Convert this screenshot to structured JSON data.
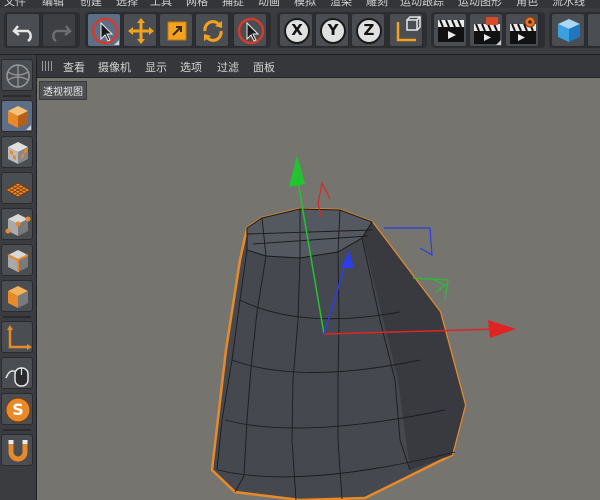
{
  "menubar": {
    "items": [
      "文件",
      "编辑",
      "创建",
      "选择",
      "工具",
      "网格",
      "捕捉",
      "动画",
      "模拟",
      "渲染",
      "雕刻",
      "运动跟踪",
      "运动图形",
      "角色",
      "流水线"
    ]
  },
  "toolbar": {
    "undo_icon": "undo-icon",
    "redo_icon": "redo-icon",
    "select_icon": "live-select-icon",
    "move_icon": "move-icon",
    "scale_icon": "scale-icon",
    "rotate_icon": "rotate-icon",
    "last_tool_icon": "last-tool-icon",
    "axis_x_label": "X",
    "axis_y_label": "Y",
    "axis_z_label": "Z",
    "coord_icon": "coordinate-system-icon",
    "render_view_icon": "render-view-icon",
    "render_picture_icon": "render-to-picture-viewer-icon",
    "render_settings_icon": "render-settings-icon",
    "cube_icon": "cube-object-icon"
  },
  "lefttools": {
    "items": [
      "make-editable-icon",
      "texture-mode-icon",
      "workplane-icon",
      "points-mode-icon",
      "edges-mode-icon",
      "polygons-mode-icon",
      "axis-mode-icon",
      "tweak-mode-icon",
      "snap-icon",
      "magnet-icon"
    ]
  },
  "viewport_menu": {
    "items": [
      "查看",
      "摄像机",
      "显示",
      "选项",
      "过滤",
      "面板"
    ]
  },
  "viewport": {
    "label": "透视视图"
  },
  "colors": {
    "viewport_bg": "#75746f",
    "mesh_face": "#4b4e55",
    "selection_outline": "#e88a2a",
    "axis_x": "#e02424",
    "axis_y": "#22c430",
    "axis_z": "#2b3ee8"
  }
}
